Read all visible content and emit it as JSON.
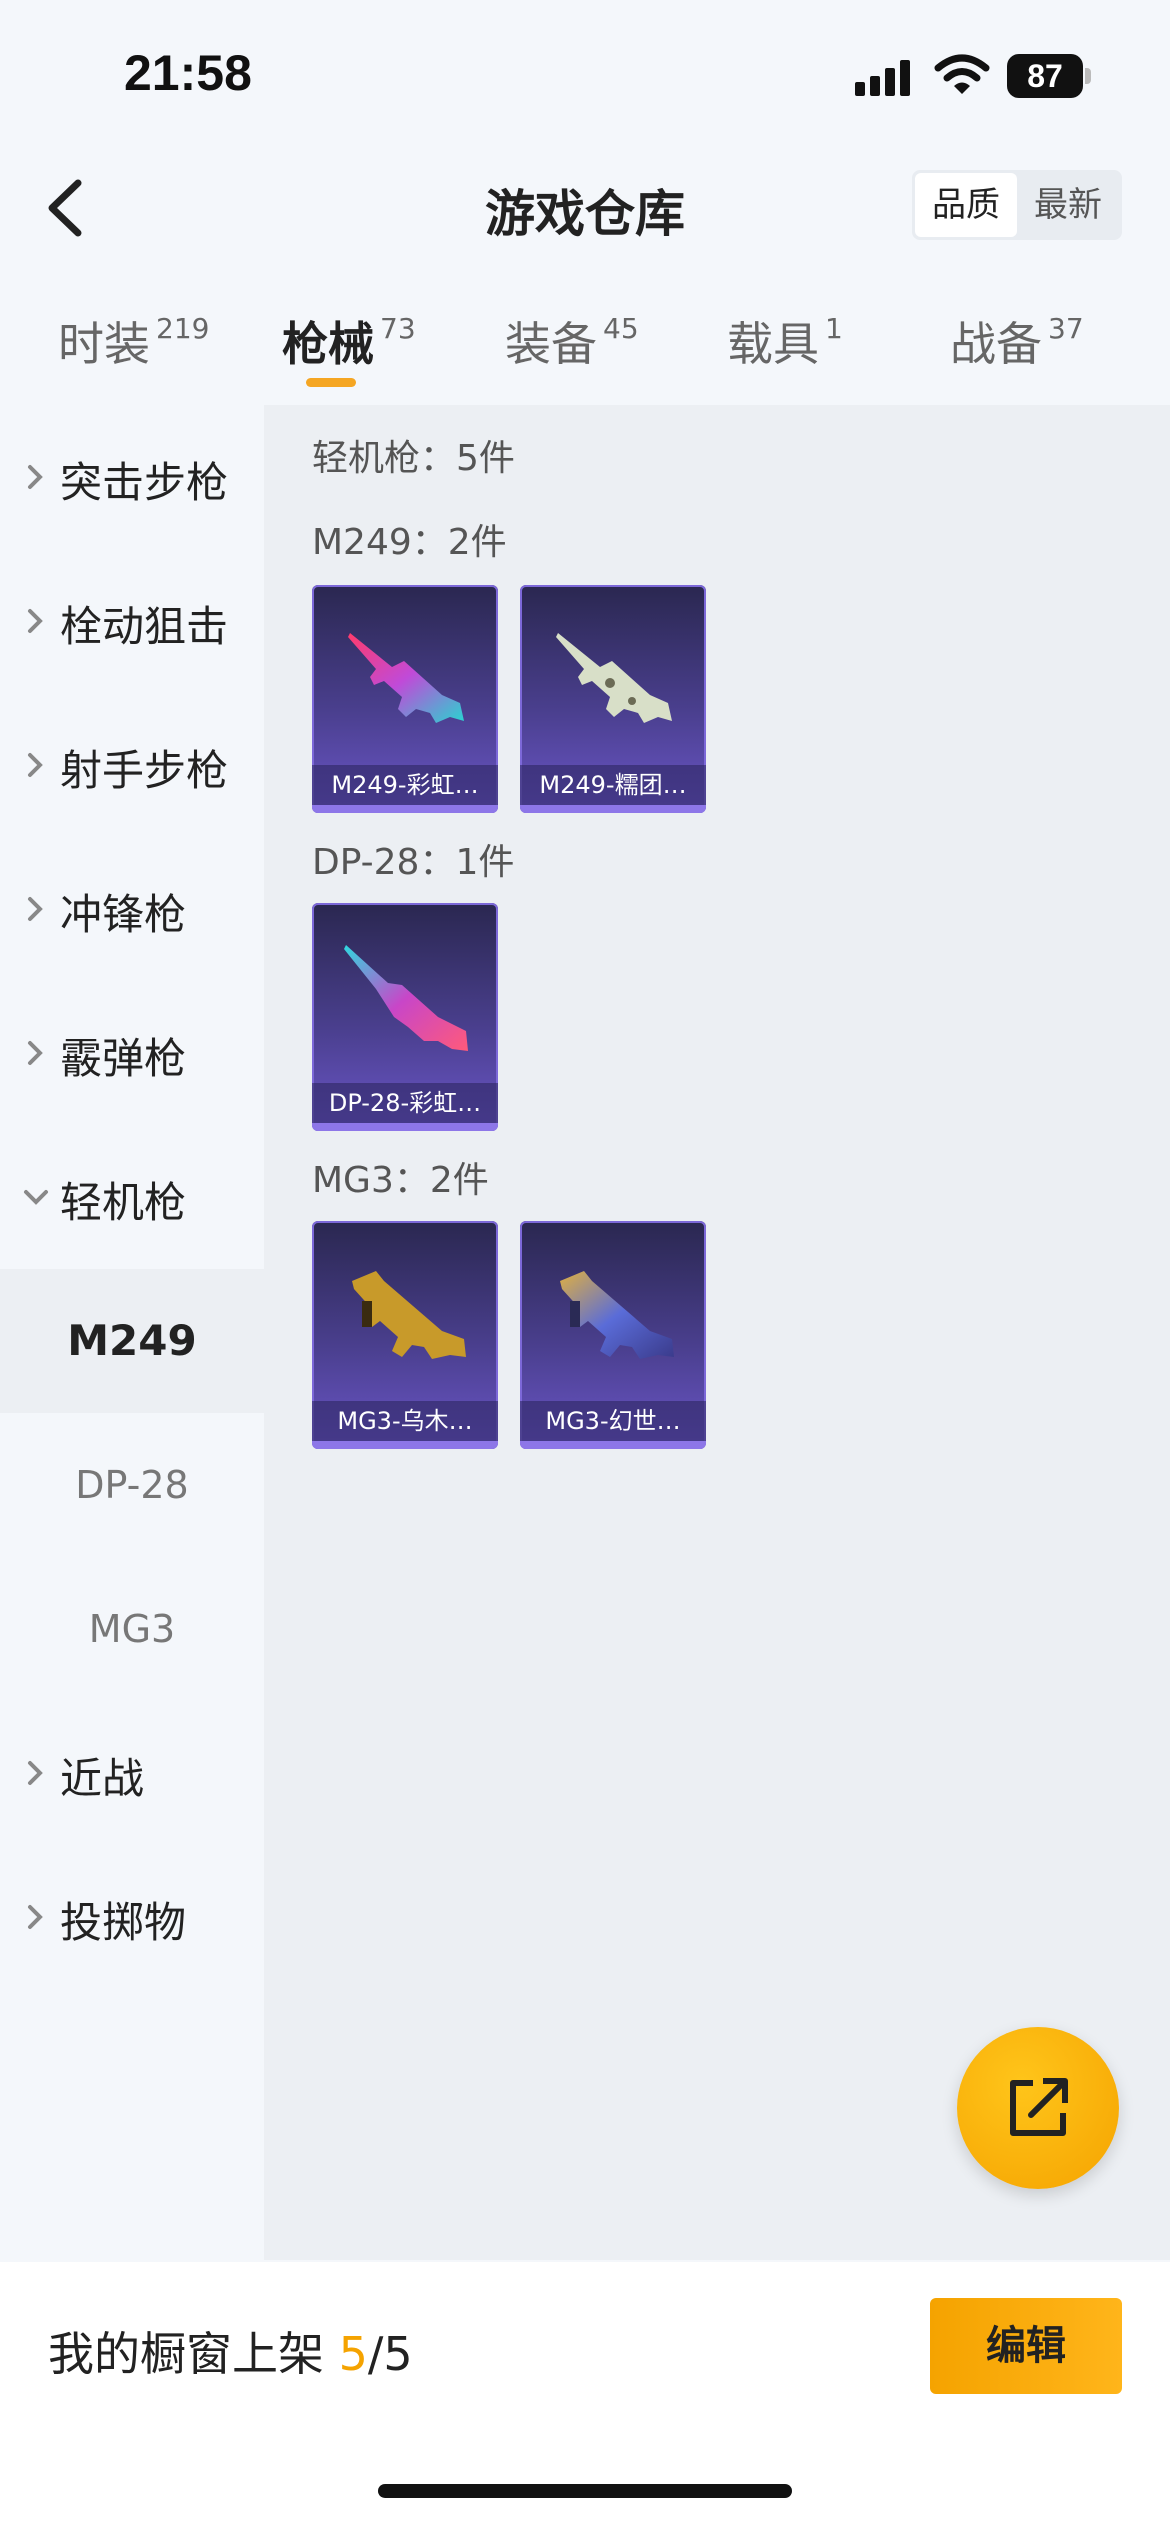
{
  "status_bar": {
    "time": "21:58",
    "battery": "87"
  },
  "header": {
    "title": "游戏仓库",
    "sort_options": [
      "品质",
      "最新"
    ],
    "active_sort": "品质"
  },
  "tabs": [
    {
      "label": "时装",
      "count": "219"
    },
    {
      "label": "枪械",
      "count": "73"
    },
    {
      "label": "装备",
      "count": "45"
    },
    {
      "label": "载具",
      "count": "1"
    },
    {
      "label": "战备",
      "count": "37"
    }
  ],
  "active_tab": "枪械",
  "sidebar": {
    "categories": [
      "突击步枪",
      "栓动狙击",
      "射手步枪",
      "冲锋枪",
      "霰弹枪",
      "轻机枪"
    ],
    "expanded": "轻机枪",
    "subitems": [
      "M249",
      "DP-28",
      "MG3"
    ],
    "active_subitem": "M249",
    "more": [
      "近战",
      "投掷物"
    ]
  },
  "content": {
    "category_title": "轻机枪：5件",
    "groups": [
      {
        "title": "M249：2件",
        "items": [
          "M249-彩虹…",
          "M249-糯团…"
        ]
      },
      {
        "title": "DP-28：1件",
        "items": [
          "DP-28-彩虹…"
        ]
      },
      {
        "title": "MG3：2件",
        "items": [
          "MG3-乌木…",
          "MG3-幻世…"
        ]
      }
    ]
  },
  "bottom": {
    "showcase_label": "我的橱窗上架 ",
    "showcase_used": "5",
    "showcase_total": "/5",
    "edit_label": "编辑"
  },
  "colors": {
    "accent": "#f5a300",
    "card_bg": "#4a3f8e",
    "content_bg": "#eceff3"
  }
}
